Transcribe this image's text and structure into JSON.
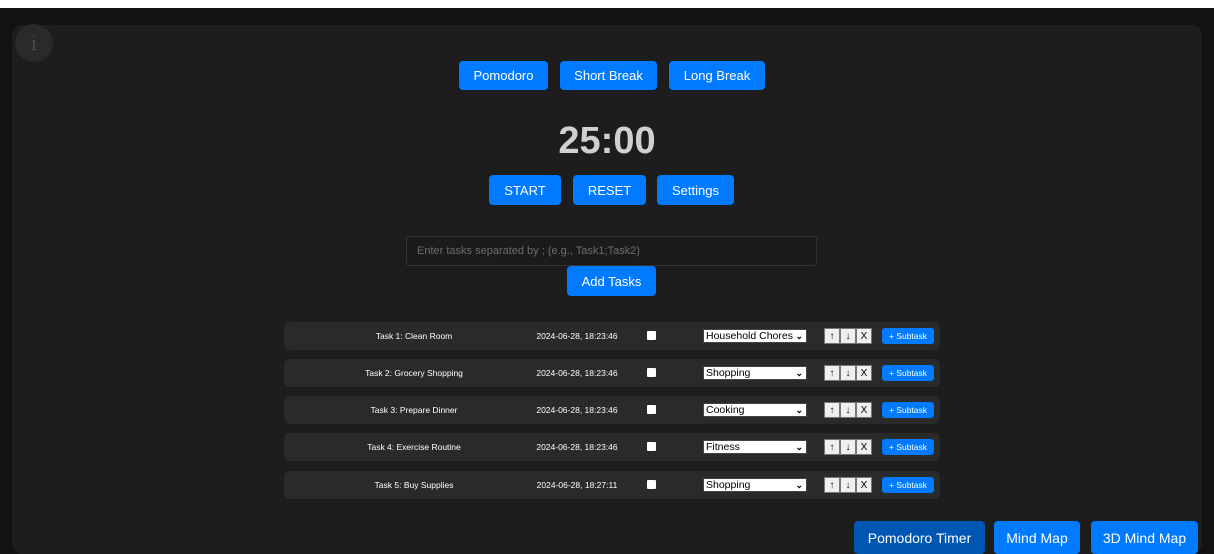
{
  "info_button": {
    "glyph": "i"
  },
  "timer_modes": [
    {
      "label": "Pomodoro"
    },
    {
      "label": "Short Break"
    },
    {
      "label": "Long Break"
    }
  ],
  "timer": {
    "display": "25:00"
  },
  "controls": {
    "start": "START",
    "reset": "RESET",
    "settings": "Settings"
  },
  "task_input": {
    "placeholder": "Enter tasks separated by ; (e.g., Task1;Task2)",
    "value": ""
  },
  "add_tasks_label": "Add Tasks",
  "task_actions": {
    "up": "↑",
    "down": "↓",
    "delete": "X",
    "subtask": "+ Subtask"
  },
  "tasks": [
    {
      "name": "Task 1: Clean Room",
      "timestamp": "2024-06-28, 18:23:46",
      "category": "Household Chores"
    },
    {
      "name": "Task 2: Grocery Shopping",
      "timestamp": "2024-06-28, 18:23:46",
      "category": "Shopping"
    },
    {
      "name": "Task 3: Prepare Dinner",
      "timestamp": "2024-06-28, 18:23:46",
      "category": "Cooking"
    },
    {
      "name": "Task 4: Exercise Routine",
      "timestamp": "2024-06-28, 18:23:46",
      "category": "Fitness"
    },
    {
      "name": "Task 5: Buy Supplies",
      "timestamp": "2024-06-28, 18:27:11",
      "category": "Shopping"
    }
  ],
  "bottom_nav": {
    "pomodoro_timer": "Pomodoro Timer",
    "mind_map": "Mind Map",
    "mind_map_3d": "3D Mind Map"
  },
  "colors": {
    "accent": "#007bff",
    "active_nav": "#0056b3",
    "background": "#121212",
    "panel": "#1d1d1d",
    "task_row": "#2a2a2a"
  }
}
